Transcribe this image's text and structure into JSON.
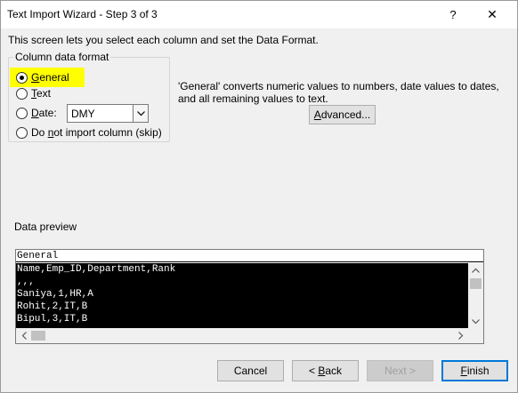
{
  "window": {
    "title": "Text Import Wizard - Step 3 of 3",
    "help": "?",
    "close": "✕"
  },
  "intro": "This screen lets you select each column and set the Data Format.",
  "format_group": {
    "legend": "Column data format",
    "general_pre": "",
    "general_acc": "G",
    "general_post": "eneral",
    "text_acc": "T",
    "text_post": "ext",
    "date_acc": "D",
    "date_post": "ate:",
    "date_value": "DMY",
    "skip_pre": "Do ",
    "skip_acc": "n",
    "skip_post": "ot import column (skip)",
    "selected": "General"
  },
  "description": "'General' converts numeric values to numbers, date values to dates, and all remaining values to text.",
  "advanced": {
    "pre": "",
    "acc": "A",
    "post": "dvanced..."
  },
  "preview": {
    "legend": "Data preview",
    "header": "General",
    "rows": [
      "Name,Emp_ID,Department,Rank",
      ",,,",
      "Saniya,1,HR,A",
      "Rohit,2,IT,B",
      "Bipul,3,IT,B"
    ]
  },
  "buttons": {
    "cancel": "Cancel",
    "back_pre": "< ",
    "back_acc": "B",
    "back_post": "ack",
    "next": "Next >",
    "finish_acc": "F",
    "finish_post": "inish"
  },
  "colors": {
    "highlight": "#ffff00",
    "focus": "#0078d7"
  },
  "icons": {
    "dropdown": "chevron-down-icon",
    "scroll_up": "chevron-up-icon",
    "scroll_down": "chevron-down-icon",
    "scroll_left": "chevron-left-icon",
    "scroll_right": "chevron-right-icon"
  }
}
